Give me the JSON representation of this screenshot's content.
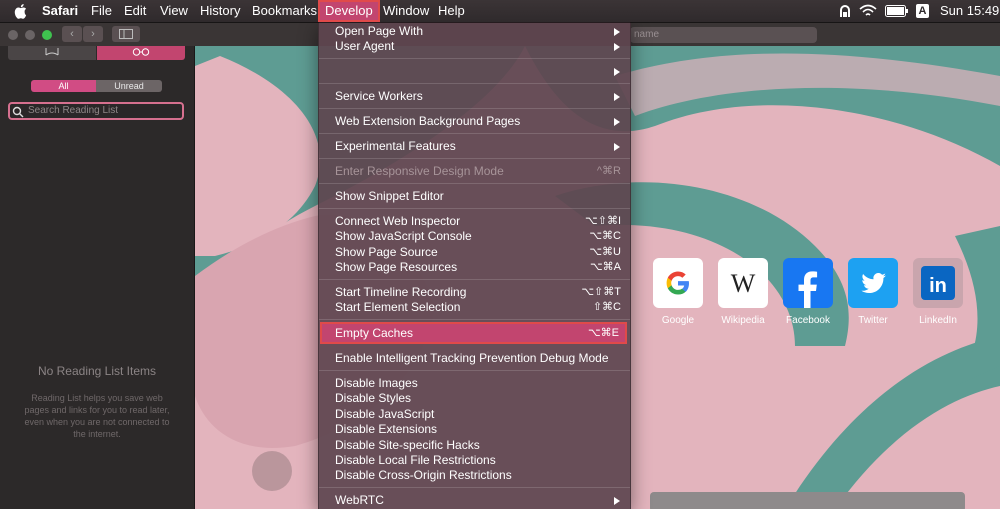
{
  "menubar": {
    "items": [
      "Safari",
      "File",
      "Edit",
      "View",
      "History",
      "Bookmarks",
      "Develop",
      "Window",
      "Help"
    ],
    "active": "Develop",
    "status_input_source": "A",
    "clock": "Sun 15:49"
  },
  "toolbar": {
    "address_placeholder": "name"
  },
  "sidebar": {
    "segment_all": "All",
    "segment_unread": "Unread",
    "search_placeholder": "Search Reading List",
    "empty_title": "No Reading List Items",
    "empty_desc": "Reading List helps you save web pages and links for you to read later, even when you are not connected to the internet."
  },
  "favorites": [
    {
      "label": "Google",
      "icon": "google-icon"
    },
    {
      "label": "Wikipedia",
      "icon": "wikipedia-icon"
    },
    {
      "label": "Facebook",
      "icon": "facebook-icon"
    },
    {
      "label": "Twitter",
      "icon": "twitter-icon"
    },
    {
      "label": "LinkedIn",
      "icon": "linkedin-icon"
    }
  ],
  "develop_menu": {
    "items": [
      {
        "label": "Open Page With",
        "shortcut": "",
        "submenu": true,
        "disabled": false
      },
      {
        "label": "User Agent",
        "shortcut": "",
        "submenu": true,
        "disabled": false
      },
      {
        "label": "",
        "shortcut": "",
        "submenu": true,
        "disabled": false
      },
      {
        "label": "Service Workers",
        "shortcut": "",
        "submenu": true,
        "disabled": false
      },
      {
        "label": "Web Extension Background Pages",
        "shortcut": "",
        "submenu": true,
        "disabled": false
      },
      {
        "label": "Experimental Features",
        "shortcut": "",
        "submenu": true,
        "disabled": false
      },
      {
        "label": "Enter Responsive Design Mode",
        "shortcut": "^⌘R",
        "submenu": false,
        "disabled": true
      },
      {
        "label": "Show Snippet Editor",
        "shortcut": "",
        "submenu": false,
        "disabled": false
      },
      {
        "label": "Connect Web Inspector",
        "shortcut": "⌥⇧⌘I",
        "submenu": false,
        "disabled": false
      },
      {
        "label": "Show JavaScript Console",
        "shortcut": "⌥⌘C",
        "submenu": false,
        "disabled": false
      },
      {
        "label": "Show Page Source",
        "shortcut": "⌥⌘U",
        "submenu": false,
        "disabled": false
      },
      {
        "label": "Show Page Resources",
        "shortcut": "⌥⌘A",
        "submenu": false,
        "disabled": false
      },
      {
        "label": "Start Timeline Recording",
        "shortcut": "⌥⇧⌘T",
        "submenu": false,
        "disabled": false
      },
      {
        "label": "Start Element Selection",
        "shortcut": "⇧⌘C",
        "submenu": false,
        "disabled": false
      },
      {
        "label": "Empty Caches",
        "shortcut": "⌥⌘E",
        "submenu": false,
        "disabled": false,
        "highlighted": true
      },
      {
        "label": "Enable Intelligent Tracking Prevention Debug Mode",
        "shortcut": "",
        "submenu": false,
        "disabled": false
      },
      {
        "label": "Disable Images",
        "shortcut": "",
        "submenu": false,
        "disabled": false
      },
      {
        "label": "Disable Styles",
        "shortcut": "",
        "submenu": false,
        "disabled": false
      },
      {
        "label": "Disable JavaScript",
        "shortcut": "",
        "submenu": false,
        "disabled": false
      },
      {
        "label": "Disable Extensions",
        "shortcut": "",
        "submenu": false,
        "disabled": false
      },
      {
        "label": "Disable Site-specific Hacks",
        "shortcut": "",
        "submenu": false,
        "disabled": false
      },
      {
        "label": "Disable Local File Restrictions",
        "shortcut": "",
        "submenu": false,
        "disabled": false
      },
      {
        "label": "Disable Cross-Origin Restrictions",
        "shortcut": "",
        "submenu": false,
        "disabled": false
      },
      {
        "label": "WebRTC",
        "shortcut": "",
        "submenu": true,
        "disabled": false
      }
    ]
  },
  "colors": {
    "accent": "#c2456f",
    "highlight_border": "#e04a4a",
    "page_bg": "#e3b4bd",
    "teal": "#5e9c93"
  }
}
